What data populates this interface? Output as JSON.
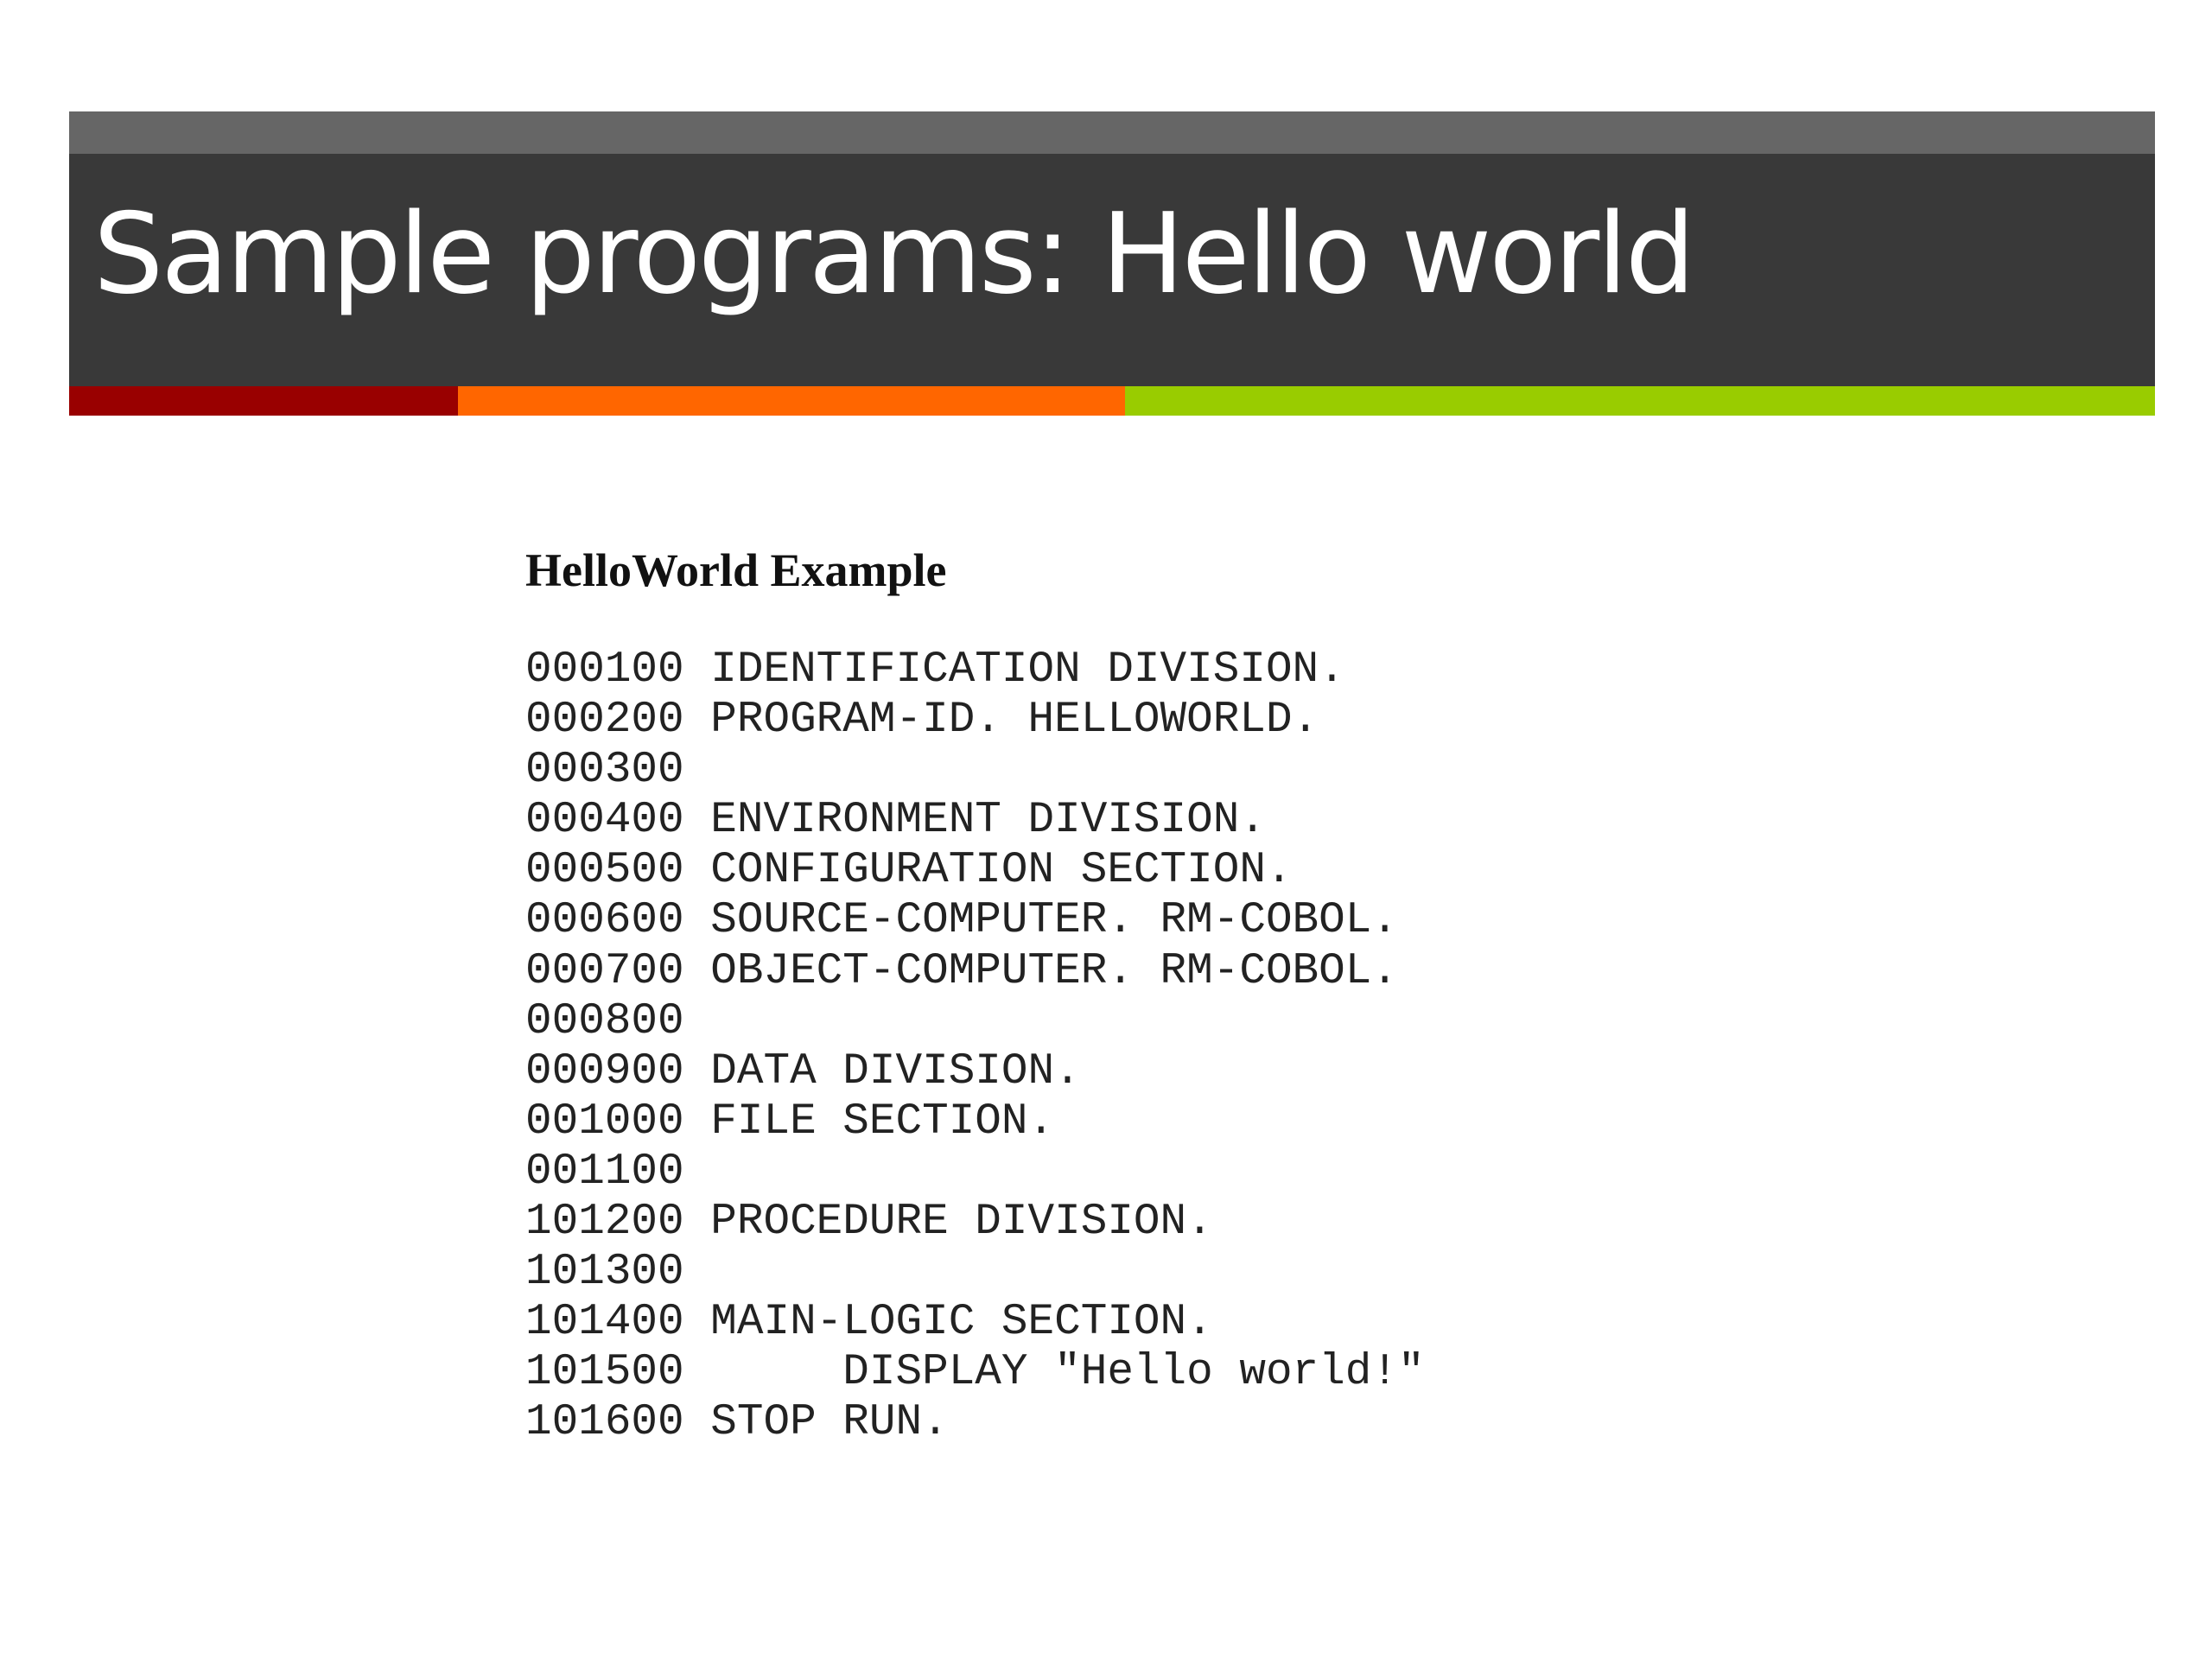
{
  "slide": {
    "title": "Sample programs: Hello world",
    "colors": {
      "title_bar_top": "#666666",
      "title_bar": "#393939",
      "title_text": "#ffffff",
      "accent_red": "#990000",
      "accent_orange": "#ff6600",
      "accent_green": "#99cc00"
    }
  },
  "example": {
    "heading": "HelloWorld Example",
    "lines": [
      {
        "num": "000100",
        "code": "IDENTIFICATION DIVISION."
      },
      {
        "num": "000200",
        "code": "PROGRAM-ID. HELLOWORLD."
      },
      {
        "num": "000300",
        "code": ""
      },
      {
        "num": "000400",
        "code": "ENVIRONMENT DIVISION."
      },
      {
        "num": "000500",
        "code": "CONFIGURATION SECTION."
      },
      {
        "num": "000600",
        "code": "SOURCE-COMPUTER. RM-COBOL."
      },
      {
        "num": "000700",
        "code": "OBJECT-COMPUTER. RM-COBOL."
      },
      {
        "num": "000800",
        "code": ""
      },
      {
        "num": "000900",
        "code": "DATA DIVISION."
      },
      {
        "num": "001000",
        "code": "FILE SECTION."
      },
      {
        "num": "001100",
        "code": ""
      },
      {
        "num": "101200",
        "code": "PROCEDURE DIVISION."
      },
      {
        "num": "101300",
        "code": ""
      },
      {
        "num": "101400",
        "code": "MAIN-LOGIC SECTION."
      },
      {
        "num": "101500",
        "code": "     DISPLAY \"Hello world!\""
      },
      {
        "num": "101600",
        "code": "STOP RUN."
      }
    ]
  }
}
